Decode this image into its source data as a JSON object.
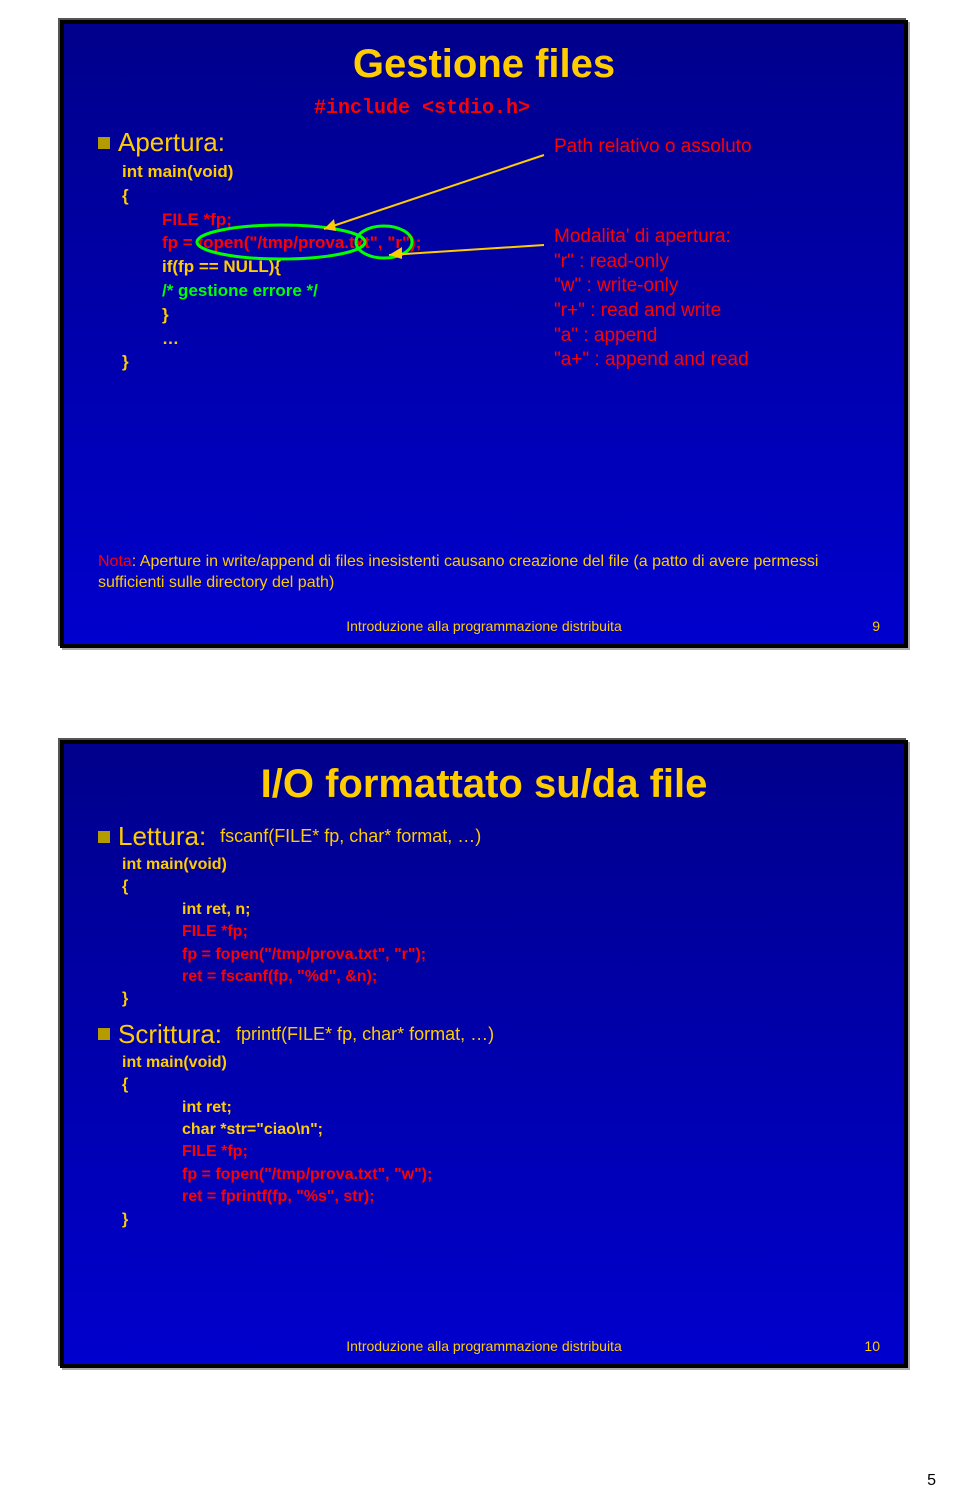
{
  "slide1": {
    "title": "Gestione files",
    "bullet": "Apertura:",
    "include": "#include <stdio.h>",
    "c1": "int main(void)",
    "c2": "{",
    "c3a": "FILE *fp;",
    "c3b": "fp = fopen(\"/tmp/prova.txt\", \"r\");",
    "c4": "if(fp == NULL){",
    "c5": "/* gestione errore */",
    "c6": "}",
    "c7": "…",
    "c8": "}",
    "a1": "Path relativo o assoluto",
    "ah": "Modalita' di apertura:",
    "m1": "\"r\" : read-only",
    "m2": "\"w\" : write-only",
    "m3": "\"r+\" : read and write",
    "m4": "\"a\" : append",
    "m5": "\"a+\" : append and read",
    "note_lead": "Nota",
    "note_body": ": Aperture in write/append di files inesistenti causano creazione del file (a patto di avere permessi sufficienti sulle directory del path)",
    "footer": "Introduzione alla programmazione distribuita",
    "page": "9"
  },
  "slide2": {
    "title": "I/O formattato su/da file",
    "b1": "Lettura:",
    "sig1": "fscanf(FILE* fp, char* format, …)",
    "l1": "int main(void)",
    "l2": "{",
    "l3": "int ret, n;",
    "l4": "FILE *fp;",
    "l5": "fp = fopen(\"/tmp/prova.txt\", \"r\");",
    "l6": "ret = fscanf(fp, \"%d\", &n);",
    "l7": "}",
    "b2": "Scrittura:",
    "sig2": "fprintf(FILE* fp, char* format, …)",
    "s1": "int main(void)",
    "s2": "{",
    "s3": "int ret;",
    "s4": "char *str=\"ciao\\n\";",
    "s5": "FILE *fp;",
    "s6": "fp = fopen(\"/tmp/prova.txt\", \"w\");",
    "s7": "ret = fprintf(fp, \"%s\", str);",
    "s8": "}",
    "footer": "Introduzione alla programmazione distribuita",
    "page": "10"
  },
  "docpage": "5"
}
